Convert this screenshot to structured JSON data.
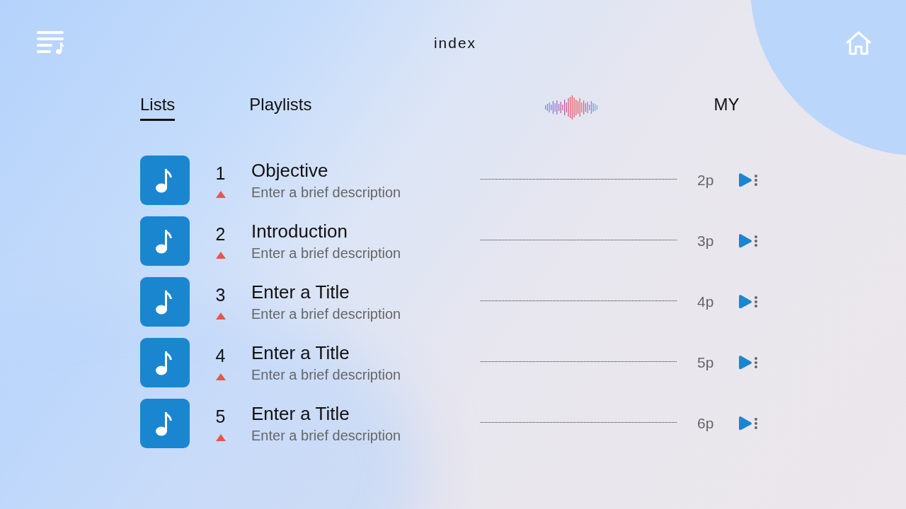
{
  "header": {
    "title": "index"
  },
  "tabs": [
    {
      "label": "Lists",
      "selected": true
    },
    {
      "label": "Playlists",
      "selected": false
    },
    {
      "label": "MY",
      "selected": false
    }
  ],
  "items": [
    {
      "number": "1",
      "title": "Objective",
      "description": "Enter a brief description",
      "page": "2p"
    },
    {
      "number": "2",
      "title": "Introduction",
      "description": "Enter a brief description",
      "page": "3p"
    },
    {
      "number": "3",
      "title": "Enter a Title",
      "description": "Enter a brief description",
      "page": "4p"
    },
    {
      "number": "4",
      "title": "Enter a Title",
      "description": "Enter a brief description",
      "page": "5p"
    },
    {
      "number": "5",
      "title": "Enter a Title",
      "description": "Enter a brief description",
      "page": "6p"
    }
  ]
}
